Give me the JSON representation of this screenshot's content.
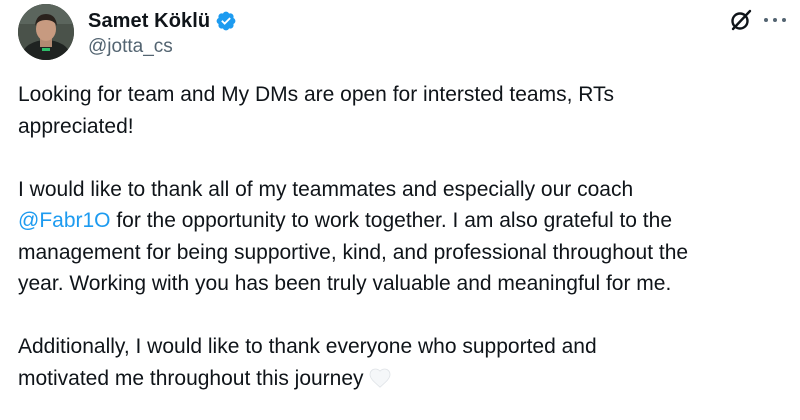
{
  "author": {
    "display_name": "Samet Köklü",
    "handle": "@jotta_cs",
    "verified": true,
    "avatar_icon": "profile-photo",
    "verified_icon": "verified-badge-icon"
  },
  "header_actions": {
    "grok_icon": "grok-icon",
    "more_icon": "more-options-icon"
  },
  "body": {
    "p1_line1": "Looking for team and My DMs are open for intersted teams, RTs",
    "p1_line2": "appreciated!",
    "p2_line1": "I would like to thank all of my teammates and especially our coach",
    "p2_mention": "@Fabr1O",
    "p2_line2_rest": " for the opportunity to work together. I am also grateful to the",
    "p2_line3": "management for being supportive, kind, and professional throughout the",
    "p2_line4": "year. Working with you has been truly valuable and meaningful for me.",
    "p3_line1": "Additionally, I would like to thank everyone who supported and",
    "p3_line2": "motivated me throughout this journey",
    "p3_emoji": "white-heart-emoji"
  },
  "colors": {
    "text": "#0f1419",
    "secondary": "#536471",
    "link": "#1d9bf0",
    "verified_badge": "#1d9bf0"
  }
}
